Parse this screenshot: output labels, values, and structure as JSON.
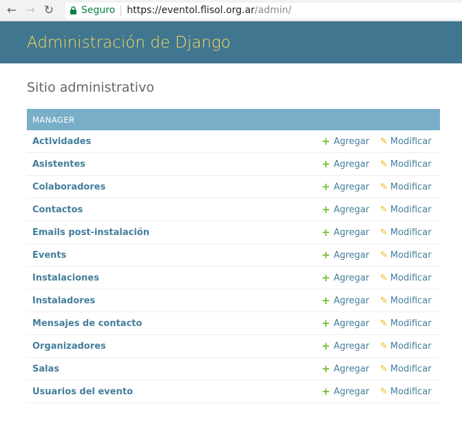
{
  "browser": {
    "secure_label": "Seguro",
    "url_main": "https://eventol.flisol.org.ar",
    "url_path": "/admin/"
  },
  "header": {
    "title": "Administración de Django"
  },
  "page": {
    "title": "Sitio administrativo"
  },
  "module": {
    "caption": "MANAGER",
    "add_label": "Agregar",
    "change_label": "Modificar",
    "rows": [
      {
        "name": "Actividades"
      },
      {
        "name": "Asistentes"
      },
      {
        "name": "Colaboradores"
      },
      {
        "name": "Contactos"
      },
      {
        "name": "Emails post-instalación"
      },
      {
        "name": "Events"
      },
      {
        "name": "Instalaciones"
      },
      {
        "name": "Instaladores"
      },
      {
        "name": "Mensajes de contacto"
      },
      {
        "name": "Organizadores"
      },
      {
        "name": "Salas"
      },
      {
        "name": "Usuarios del evento"
      }
    ]
  },
  "colors": {
    "header_bg": "#417690",
    "header_title": "#f5dd5d",
    "caption_bg": "#79aec8",
    "link": "#447e9b",
    "add_icon": "#70bf2b",
    "change_icon": "#efb80b"
  },
  "icons": {
    "back": "arrow-left-icon",
    "forward": "arrow-right-icon",
    "reload": "reload-icon",
    "secure": "lock-icon",
    "add": "plus-icon",
    "change": "pencil-icon"
  }
}
